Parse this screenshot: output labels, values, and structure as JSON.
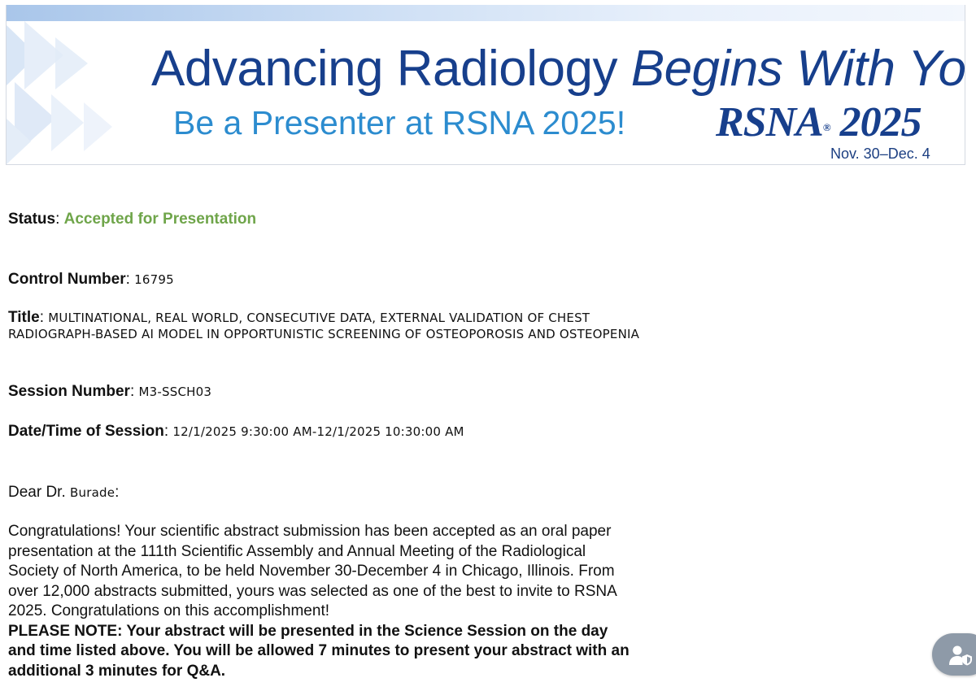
{
  "banner": {
    "headline_part1": "Advancing Radiology ",
    "headline_part2": "Begins With You",
    "subheadline": "Be a Presenter at RSNA 2025!",
    "logo_text": "RSNA",
    "logo_reg": "®",
    "logo_year": " 2025",
    "dates": "Nov. 30–Dec. 4",
    "colors": {
      "headline": "#173f8c",
      "subheadline": "#2c8ccf"
    }
  },
  "fields": {
    "status_label": "Status",
    "status_value": "Accepted for Presentation",
    "status_color": "#6fa54a",
    "control_label": "Control Number",
    "control_value": "16795",
    "title_label": "Title",
    "title_value": "MULTINATIONAL, REAL WORLD, CONSECUTIVE DATA, EXTERNAL VALIDATION OF CHEST RADIOGRAPH-BASED AI MODEL IN OPPORTUNISTIC SCREENING OF OSTEOPOROSIS AND OSTEOPENIA",
    "session_label": "Session Number",
    "session_value": "M3-SSCH03",
    "datetime_label": "Date/Time of Session",
    "datetime_value": "12/1/2025 9:30:00 AM-12/1/2025 10:30:00 AM",
    "separator": ": "
  },
  "letter": {
    "salutation_prefix": "Dear Dr.",
    "salutation_name": "Burade",
    "salutation_suffix": ":",
    "body": "Congratulations! Your scientific abstract submission has been accepted as an oral paper presentation at the 111th Scientific Assembly and Annual Meeting of the Radiological Society of North America, to be held November 30-December 4 in Chicago, Illinois. From over 12,000 abstracts submitted, yours was selected as one of the best to invite to RSNA 2025. Congratulations on this accomplishment!",
    "note_label": "PLEASE NOTE",
    "note_text": ": Your abstract will be presented in the Science Session on the day and time listed above. You will be allowed 7 minutes to present your abstract with an additional 3 minutes for Q&A."
  },
  "fab": {
    "icon": "user-shield-icon",
    "color": "#8e9aa8"
  }
}
